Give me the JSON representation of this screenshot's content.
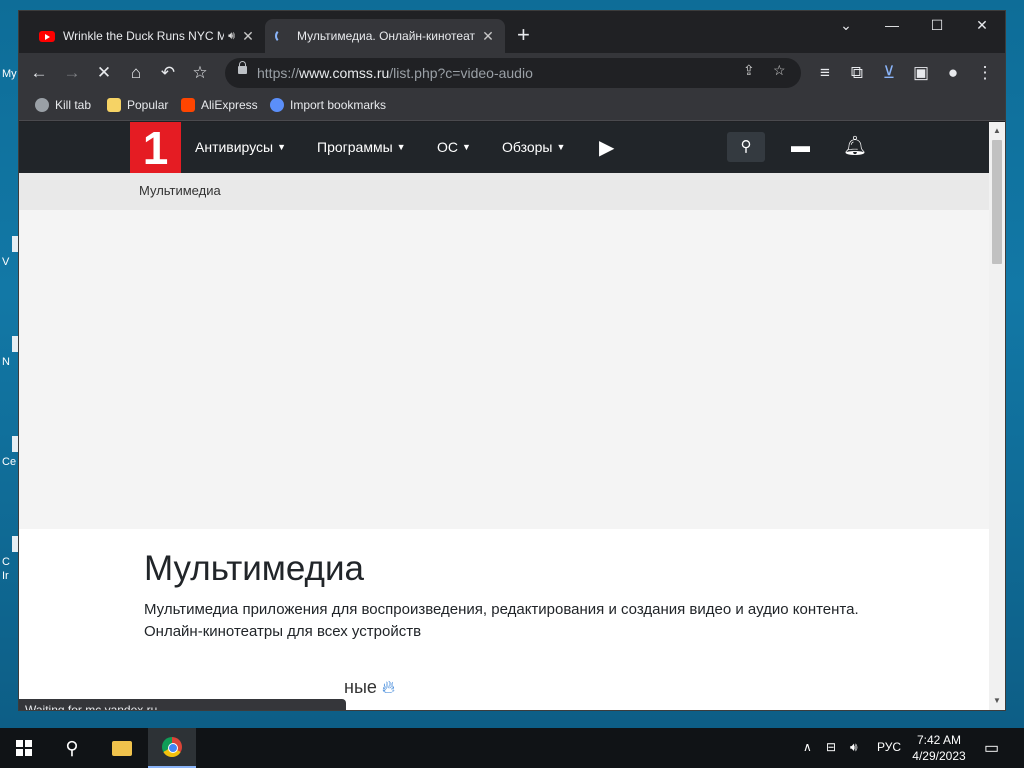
{
  "desktop": {
    "icons": [
      {
        "label": "My"
      },
      {
        "label": "V"
      },
      {
        "label": "N"
      },
      {
        "label": "Ce"
      },
      {
        "label": "C"
      },
      {
        "label": "Ir"
      }
    ]
  },
  "browser": {
    "tabs": [
      {
        "title": "Wrinkle the Duck Runs NYC M",
        "icon": "youtube-icon",
        "close": "✕"
      },
      {
        "title": "Мультимедиа. Онлайн-кинотеатры",
        "icon": "loading-spinner-icon",
        "close": "✕"
      }
    ],
    "new_tab": "+",
    "window_controls": {
      "chevron": "⌄",
      "minimize": "—",
      "maximize": "☐",
      "close": "✕"
    },
    "url": {
      "scheme": "https://",
      "host": "www.comss.ru",
      "path": "/list.php?c=video-audio"
    },
    "bookmarks": [
      {
        "label": "Kill tab",
        "color": "#9aa0a6"
      },
      {
        "label": "Popular",
        "color": "#f6d365"
      },
      {
        "label": "AliExpress",
        "color": "#ff4500"
      },
      {
        "label": "Import bookmarks",
        "color": "#5b8ff9"
      }
    ],
    "status": "Waiting for mc.yandex.ru..."
  },
  "site": {
    "logo": "1",
    "nav": [
      {
        "label": "Антивирусы"
      },
      {
        "label": "Программы"
      },
      {
        "label": "ОС"
      },
      {
        "label": "Обзоры"
      }
    ],
    "breadcrumb": "Мультимедиа",
    "heading": "Мультимедиа",
    "description": "Мультимедиа приложения для воспроизведения, редактирования и создания видео и аудио контента. Онлайн-кинотеатры для всех устройств",
    "section_partial": "ные"
  },
  "taskbar": {
    "language": "РУС",
    "time": "7:42 AM",
    "date": "4/29/2023"
  },
  "colors": {
    "accent_red": "#e51c23",
    "nav_bg": "#212529",
    "chrome_dark": "#202124"
  }
}
